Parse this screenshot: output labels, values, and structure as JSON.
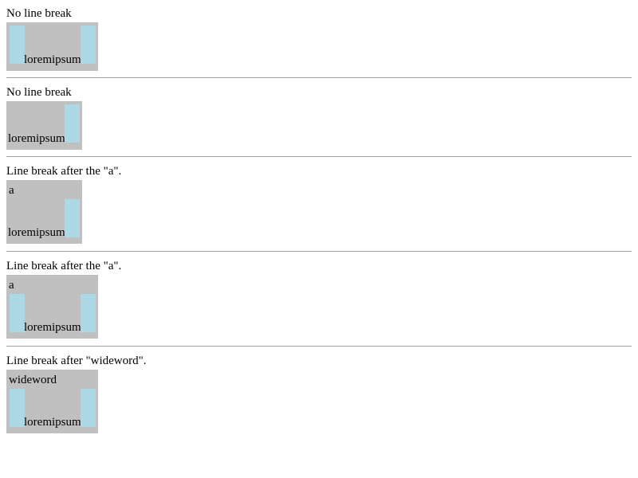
{
  "sections": [
    {
      "caption": "No line break",
      "first_line": "",
      "label": "loremipsum"
    },
    {
      "caption": "No line break",
      "first_line": "",
      "label": "loremipsum"
    },
    {
      "caption": "Line break after the \"a\".",
      "first_line": "a",
      "label": "loremipsum"
    },
    {
      "caption": "Line break after the \"a\".",
      "first_line": "a",
      "label": "loremipsum"
    },
    {
      "caption": "Line break after \"wideword\".",
      "first_line": "wideword",
      "label": "loremipsum"
    }
  ],
  "colors": {
    "box": "#c0c0c0",
    "block": "#add8e6",
    "rule": "#a0a0a0"
  }
}
